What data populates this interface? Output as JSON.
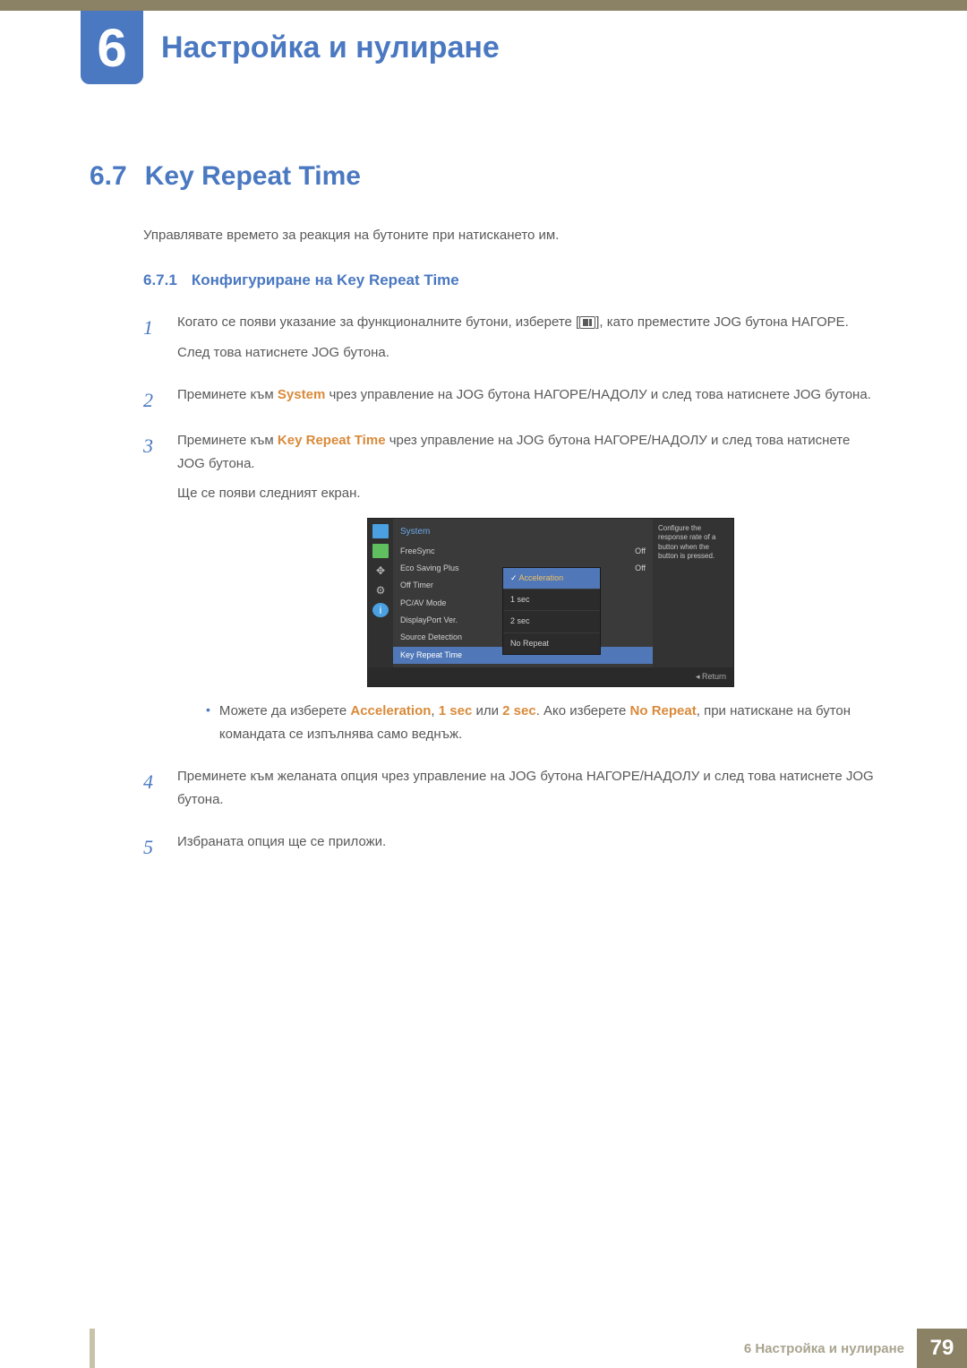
{
  "chapter": {
    "number": "6",
    "title": "Настройка и нулиране"
  },
  "section": {
    "number": "6.7",
    "title": "Key Repeat Time",
    "intro": "Управлявате времето за реакция на бутоните при натискането им."
  },
  "subsection": {
    "number": "6.7.1",
    "title": "Конфигуриране на Key Repeat Time"
  },
  "steps": {
    "s1": {
      "num": "1",
      "p1a": "Когато се появи указание за функционалните бутони, изберете [",
      "p1b": "], като преместите JOG бутона НАГОРЕ.",
      "p2": "След това натиснете JOG бутона."
    },
    "s2": {
      "num": "2",
      "pre": "Преминете към ",
      "hl": "System",
      "post": " чрез управление на JOG бутона НАГОРЕ/НАДОЛУ и след това натиснете JOG бутона."
    },
    "s3": {
      "num": "3",
      "pre": "Преминете към ",
      "hl": "Key Repeat Time",
      "post": " чрез управление на JOG бутона НАГОРЕ/НАДОЛУ и след това натиснете JOG бутона.",
      "p2": "Ще се появи следният екран."
    },
    "s4": {
      "num": "4",
      "text": "Преминете към желаната опция чрез управление на JOG бутона НАГОРЕ/НАДОЛУ и след това натиснете JOG бутона."
    },
    "s5": {
      "num": "5",
      "text": "Избраната опция ще се приложи."
    }
  },
  "bullet": {
    "t1": "Можете да изберете ",
    "h1": "Acceleration",
    "t2": ", ",
    "h2": "1 sec",
    "t3": " или ",
    "h3": "2 sec",
    "t4": ". Ако изберете ",
    "h4": "No Repeat",
    "t5": ", при натискане на бутон командата се изпълнява само веднъж."
  },
  "osd": {
    "header": "System",
    "items": {
      "freesync": {
        "label": "FreeSync",
        "value": "Off"
      },
      "eco": {
        "label": "Eco Saving Plus",
        "value": "Off"
      },
      "offtimer": {
        "label": "Off Timer",
        "value": ""
      },
      "pcav": {
        "label": "PC/AV Mode",
        "value": ""
      },
      "dpver": {
        "label": "DisplayPort Ver.",
        "value": ""
      },
      "srcdet": {
        "label": "Source Detection",
        "value": ""
      },
      "krt": {
        "label": "Key Repeat Time",
        "value": ""
      }
    },
    "submenu": {
      "accel": "Acceleration",
      "s1": "1 sec",
      "s2": "2 sec",
      "nr": "No Repeat"
    },
    "help": "Configure the response rate of a button when the button is pressed.",
    "return": "Return"
  },
  "footer": {
    "text": "6 Настройка и нулиране",
    "page": "79"
  }
}
